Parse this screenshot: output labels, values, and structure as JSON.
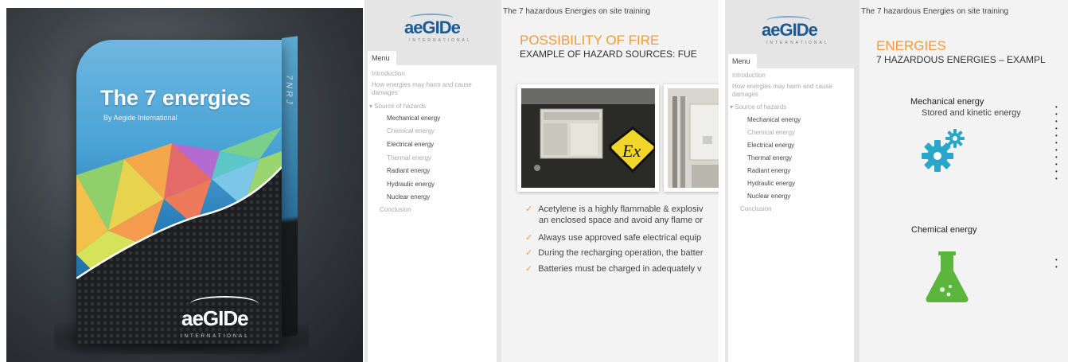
{
  "product_box": {
    "title": "The 7 energies",
    "subtitle": "By Aegide International",
    "side_text": "7NRJ",
    "logo": "aeGIDe",
    "logo_sub": "INTERNATIONAL"
  },
  "app_left": {
    "logo": "aeGIDe",
    "logo_sub": "INTERNATIONAL",
    "menu_tab": "Menu",
    "menu_items": [
      "Introduction",
      "How energies may harm and cause damages",
      "▾ Source of hazards",
      "Mechanical energy",
      "Chemical energy",
      "Electrical energy",
      "Thermal energy",
      "Radiant energy",
      "Hydraulic energy",
      "Nuclear energy",
      "Conclusion"
    ],
    "course_title": "The 7 hazardous Energies on site training",
    "slide_title": "POSSIBILITY OF FIRE",
    "slide_subtitle": "EXAMPLE OF HAZARD SOURCES: FUE",
    "bullets": [
      "Acetylene is a highly flammable & explosiv",
      "an enclosed space and avoid any flame or",
      "Always use approved safe electrical equip",
      "During the recharging operation, the batter",
      "Batteries must be charged in adequately v"
    ],
    "ex_symbol": "Ex",
    "player_mute": "🔈",
    "player_play": "▶"
  },
  "app_right": {
    "logo": "aeGIDe",
    "logo_sub": "INTERNATIONAL",
    "menu_tab": "Menu",
    "menu_items": [
      "Introduction",
      "How energies may harm and cause damages",
      "▾ Source of hazards",
      "Mechanical energy",
      "Chemical energy",
      "Electrical energy",
      "Thermal energy",
      "Radiant energy",
      "Hydraulic energy",
      "Nuclear energy",
      "Conclusion"
    ],
    "course_title": "The 7 hazardous Energies on site training",
    "slide_title": "ENERGIES",
    "slide_subtitle": "7 HAZARDOUS ENERGIES – EXAMPL",
    "mechanical_label": "Mechanical energy",
    "mechanical_sub": "Stored and kinetic energy",
    "chemical_label": "Chemical energy",
    "player_mute": "🔈",
    "player_play": "▶"
  },
  "colors": {
    "accent_orange": "#f39a3a",
    "icon_teal": "#29a7c9",
    "flask_green": "#5cb53d",
    "logo_blue": "#1a5b96"
  }
}
